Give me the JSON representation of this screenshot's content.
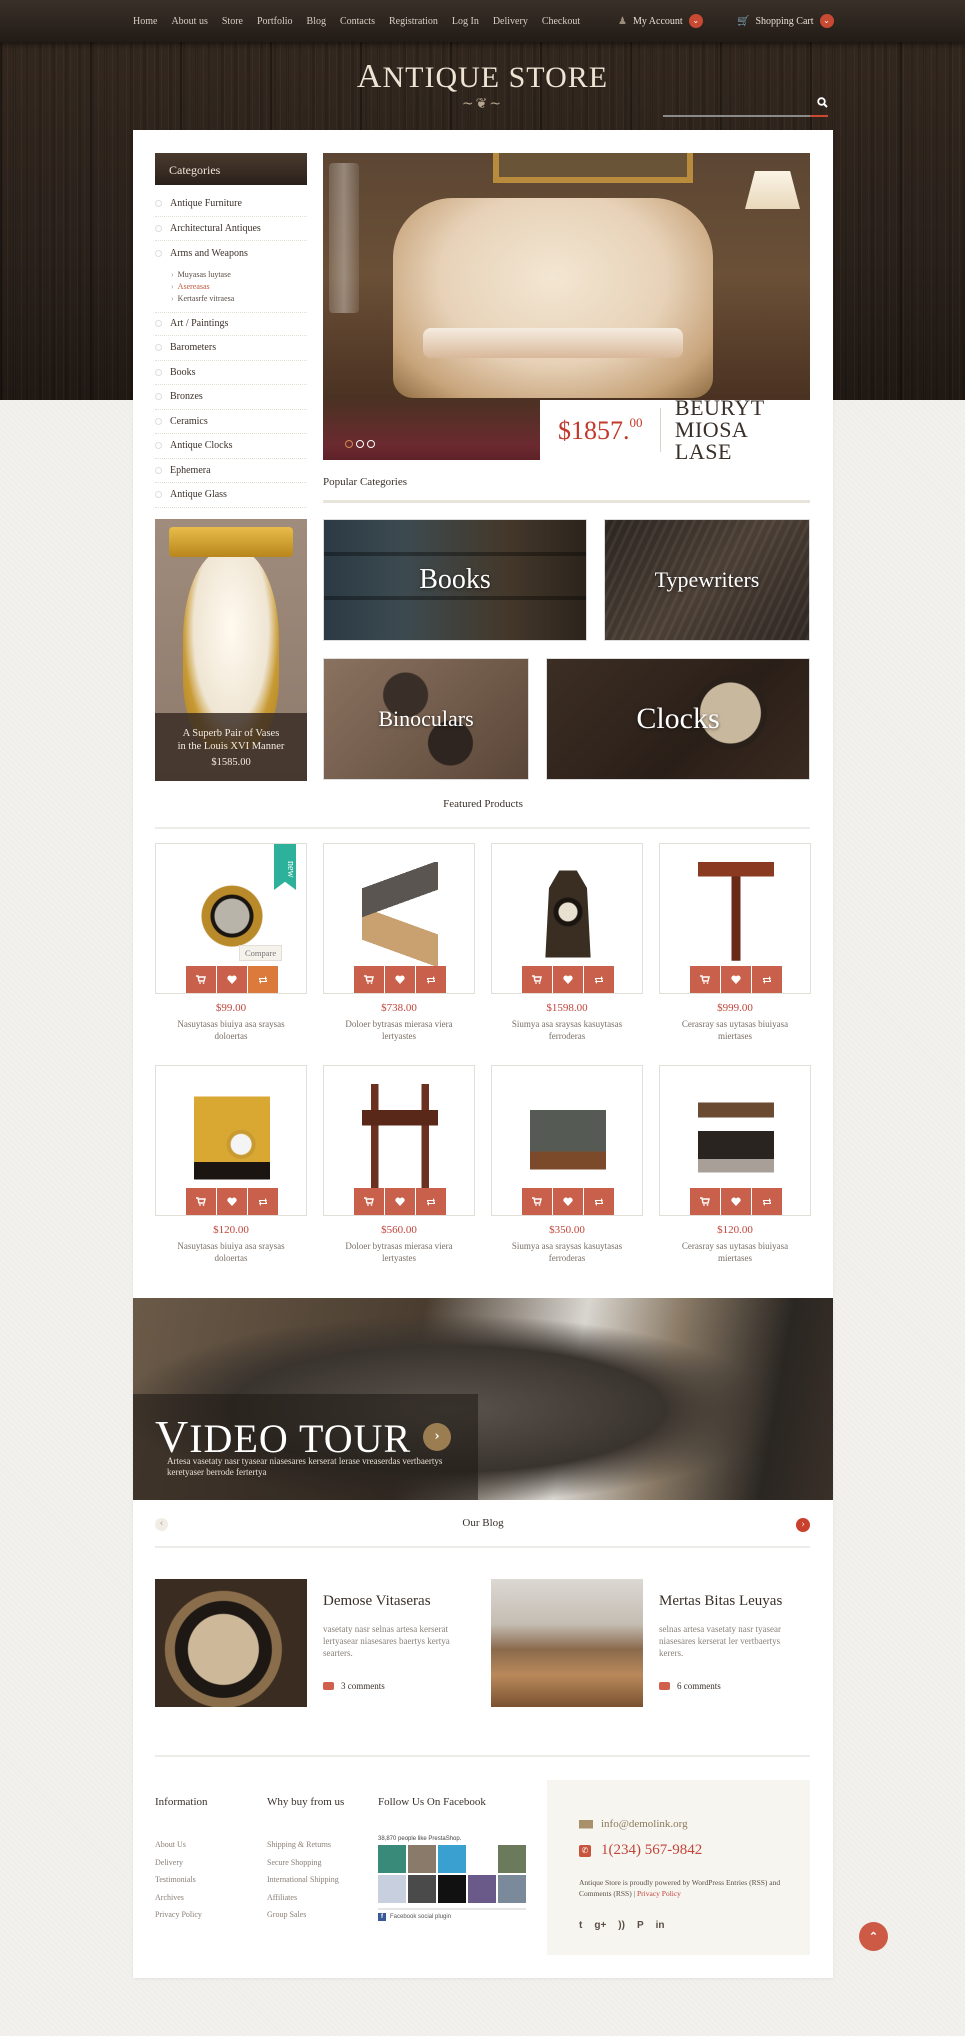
{
  "topnav": {
    "links": [
      "Home",
      "About us",
      "Store",
      "Portfolio",
      "Blog",
      "Contacts",
      "Registration",
      "Log In",
      "Delivery",
      "Checkout"
    ],
    "account_label": "My Account",
    "cart_label": "Shopping Cart",
    "account_icon": "user-icon",
    "cart_icon": "cart-icon",
    "dropdown_glyph": "⌄"
  },
  "header": {
    "logo_first": "A",
    "logo_rest": "NTIQUE STORE",
    "flourish": "~❦~",
    "search_icon": "search-icon",
    "search_glyph": "⚲"
  },
  "sidebar": {
    "title": "Categories",
    "items": [
      {
        "label": "Antique Furniture"
      },
      {
        "label": "Architectural Antiques"
      },
      {
        "label": "Arms and Weapons"
      },
      {
        "label": "Art / Paintings"
      },
      {
        "label": "Barometers"
      },
      {
        "label": "Books"
      },
      {
        "label": "Bronzes"
      },
      {
        "label": "Ceramics"
      },
      {
        "label": "Antique Clocks"
      },
      {
        "label": "Ephemera"
      },
      {
        "label": "Antique Glass"
      }
    ],
    "subitems": [
      {
        "label": "Muyasas luytase",
        "active": false
      },
      {
        "label": "Asereasas",
        "active": true
      },
      {
        "label": "Kertasrfe vitraesa",
        "active": false
      }
    ]
  },
  "slider": {
    "price_main": "$1857.",
    "price_cents": "00",
    "name_line1": "BEURYT",
    "name_line2": "MIOSA LASE",
    "dots_count": 3,
    "active_dot": 1
  },
  "popular": {
    "title": "Popular Categories",
    "tiles": [
      "Books",
      "Typewriters",
      "Binoculars",
      "Clocks"
    ]
  },
  "promo": {
    "line1": "A Superb Pair of Vases",
    "line2": "in the Louis XVI Manner",
    "price": "$1585.00"
  },
  "featured": {
    "title": "Featured Products",
    "badge_new": "new",
    "tooltip": "Compare",
    "products": [
      {
        "price": "$99.00",
        "desc": "Nasuytasas biuiya asa sraysas doloertas",
        "kind": "mirror"
      },
      {
        "price": "$738.00",
        "desc": "Doloer bytrasas mierasa viera lertyastes",
        "kind": "revolver"
      },
      {
        "price": "$1598.00",
        "desc": "Siumya asa sraysas kasuytasas ferroderas",
        "kind": "mantel-clock"
      },
      {
        "price": "$999.00",
        "desc": "Cerasray sas uytasas biuiyasa miertases",
        "kind": "tilt-table"
      },
      {
        "price": "$120.00",
        "desc": "Nasuytasas biuiya asa sraysas doloertas",
        "kind": "gilt-clock"
      },
      {
        "price": "$560.00",
        "desc": "Doloer bytrasas mierasa viera lertyastes",
        "kind": "table"
      },
      {
        "price": "$350.00",
        "desc": "Siumya asa sraysas kasuytasas ferroderas",
        "kind": "typewriter"
      },
      {
        "price": "$120.00",
        "desc": "Cerasray sas uytasas biuiyasa miertases",
        "kind": "iron"
      }
    ],
    "button_icons": [
      "cart-icon",
      "heart-icon",
      "compare-icon"
    ]
  },
  "video": {
    "title_first": "V",
    "title_rest": "IDEO TOUR",
    "desc": "Artesa vasetaty nasr tyasear niasesares kerserat lerase vreaserdas vertbaertys keretyaser berrode fertertya",
    "play_glyph": "›"
  },
  "blog": {
    "title": "Our Blog",
    "prev_glyph": "‹",
    "next_glyph": "›",
    "posts": [
      {
        "title": "Demose Vitaseras",
        "desc": "vasetaty nasr selnas artesa kerserat lertyasear niasesares baertys kertya searters.",
        "comments": "3 comments"
      },
      {
        "title": "Mertas Bitas Leuyas",
        "desc": "selnas artesa vasetaty nasr tyasear niasesares kerserat ler vertbaertys kerers.",
        "comments": "6 comments"
      }
    ]
  },
  "footer": {
    "info": {
      "title": "Information",
      "links": [
        "About Us",
        "Delivery",
        "Testimonials",
        "Archives",
        "Privacy Policy"
      ]
    },
    "why": {
      "title": "Why buy from us",
      "links": [
        "Shipping & Returns",
        "Secure Shopping",
        "International Shipping",
        "Affiliates",
        "Group Sales"
      ]
    },
    "facebook": {
      "title": "Follow Us On Facebook",
      "count_text": "38,870 people like PrestaShop.",
      "plugin_text": "Facebook social plugin",
      "avatar_colors": [
        "#3a8a7a",
        "#8a7a6a",
        "#3aa0d0",
        "#ffffff",
        "#6a7a5a",
        "#c8d0e0",
        "#4a4a4a",
        "#111111",
        "#6a5a8a",
        "#7a8a9a"
      ]
    },
    "contact": {
      "email": "info@demolink.org",
      "phone": "1(234) 567-9842",
      "copy_text": "Antique Store is proudly powered by WordPress Entries (RSS) and Comments (RSS)",
      "separator": " | ",
      "privacy_link": "Privacy Policy",
      "social": [
        {
          "name": "twitter-icon",
          "glyph": "t"
        },
        {
          "name": "google-plus-icon",
          "glyph": "g+"
        },
        {
          "name": "rss-icon",
          "glyph": "))"
        },
        {
          "name": "pinterest-icon",
          "glyph": "P"
        },
        {
          "name": "linkedin-icon",
          "glyph": "in"
        }
      ]
    }
  },
  "back_to_top_glyph": "⌃",
  "colors": {
    "accent_red": "#c9604b",
    "price_red": "#c0453a",
    "badge_teal": "#2eb19a",
    "wood_dark": "#2e241e",
    "page_bg": "#f3f1ed"
  }
}
